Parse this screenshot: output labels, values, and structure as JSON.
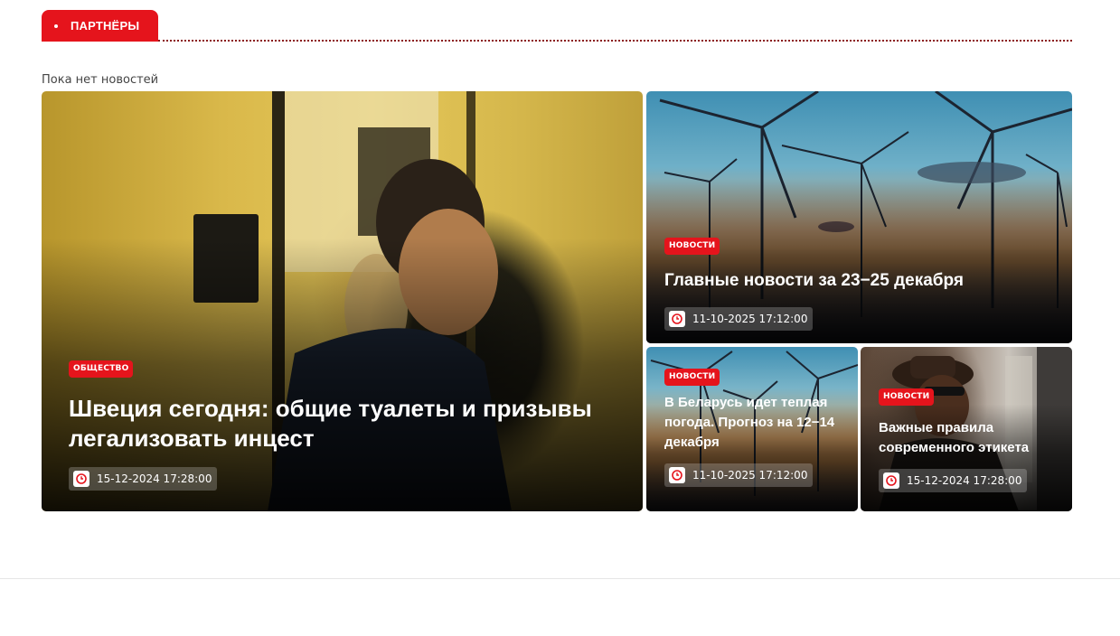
{
  "section": {
    "title": "ПАРТНЁРЫ"
  },
  "empty_message": "Пока нет новостей",
  "articles": [
    {
      "category": "ОБЩЕСТВО",
      "title": "Швеция сегодня: общие туалеты и призывы легализовать инцест",
      "date": "15-12-2024 17:28:00",
      "image": "person-in-restroom-photo"
    },
    {
      "category": "НОВОСТИ",
      "title": "Главные новости за 23−25 декабря",
      "date": "11-10-2025 17:12:00",
      "image": "wind-turbines-photo"
    },
    {
      "category": "НОВОСТИ",
      "title": "В Беларусь идет теплая погода. Прогноз на 12−14 декабря",
      "date": "11-10-2025 17:12:00",
      "image": "wind-turbines-photo"
    },
    {
      "category": "НОВОСТИ",
      "title": "Важные правила современного этикета",
      "date": "15-12-2024 17:28:00",
      "image": "man-in-hat-photo"
    }
  ],
  "colors": {
    "accent": "#e5141c",
    "divider": "#8b1a1a"
  }
}
